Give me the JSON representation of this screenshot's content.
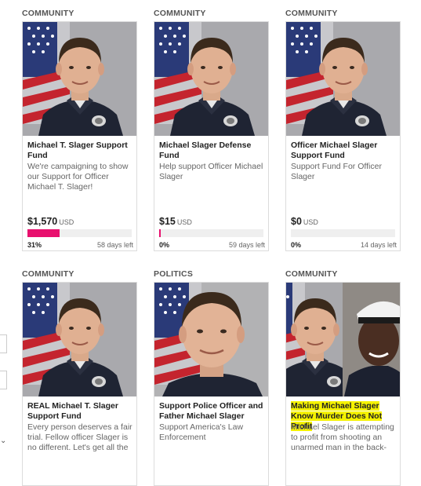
{
  "campaigns": [
    {
      "category": "COMMUNITY",
      "title": "Michael T. Slager Support Fund",
      "description": "We're campaigning to show our Support for Officer Michael T. Slager!",
      "amount": "$1,570",
      "currency": "USD",
      "percent_label": "31%",
      "progress": 0.31,
      "days_left": "58 days left"
    },
    {
      "category": "COMMUNITY",
      "title": "Michael Slager Defense Fund",
      "description": "Help support Officer Michael Slager",
      "amount": "$15",
      "currency": "USD",
      "percent_label": "0%",
      "progress": 0.01,
      "days_left": "59 days left"
    },
    {
      "category": "COMMUNITY",
      "title": "Officer Michael Slager Support Fund",
      "description": "Support Fund For Officer Slager",
      "amount": "$0",
      "currency": "USD",
      "percent_label": "0%",
      "progress": 0,
      "days_left": "14 days left"
    },
    {
      "category": "COMMUNITY",
      "title": "REAL Michael T. Slager Support Fund",
      "description": "Every person deserves a fair trial. Fellow officer Slager is no different. Let's get all the"
    },
    {
      "category": "POLITICS",
      "title": "Support Police Officer and Father Michael Slager",
      "description": "Support America's Law Enforcement"
    },
    {
      "category": "COMMUNITY",
      "title": "Making Michael Slager Know Murder Does Not Profit",
      "description": "Michael Slager is attempting to profit from shooting an unarmed man in the back-"
    }
  ],
  "colors": {
    "progress_fill": "#e8106e",
    "highlight": "#f5f200",
    "category_text": "#555555"
  },
  "icons": {
    "left_edge": "chevron-icon"
  },
  "left_edge_glyph": "⌄"
}
